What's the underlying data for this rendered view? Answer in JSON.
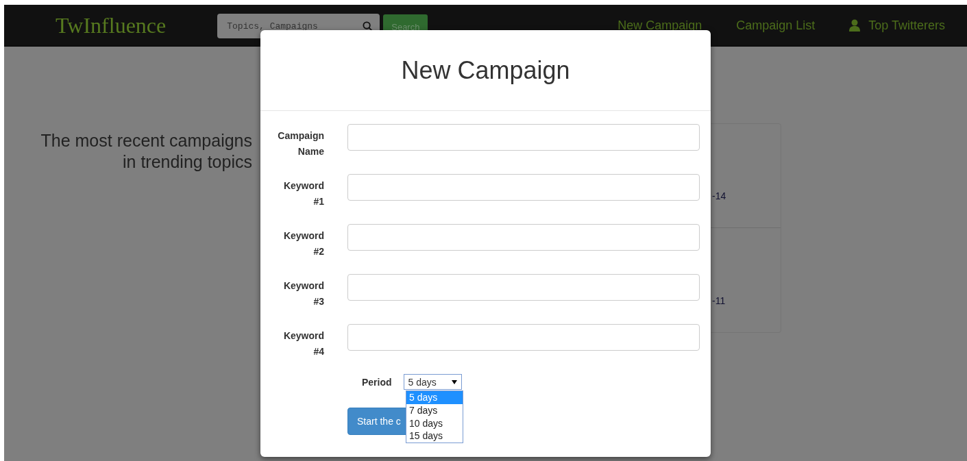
{
  "navbar": {
    "logo": "TwInfluence",
    "search": {
      "placeholder": "Topics, Campaigns",
      "button": "Search"
    },
    "links": [
      {
        "label": "New Campaign",
        "kind": "text"
      },
      {
        "label": "Campaign List",
        "kind": "text"
      },
      {
        "label": "Top Twitterers",
        "kind": "user"
      }
    ]
  },
  "intro": "The most recent campaigns in trending topics",
  "entries": [
    {
      "text": "-14"
    },
    {
      "text": "-11"
    }
  ],
  "modal": {
    "title": "New Campaign",
    "fields": [
      {
        "label": "Campaign Name"
      },
      {
        "label": "Keyword #1"
      },
      {
        "label": "Keyword #2"
      },
      {
        "label": "Keyword #3"
      },
      {
        "label": "Keyword #4"
      }
    ],
    "period": {
      "label": "Period",
      "value": "5 days",
      "options": [
        {
          "label": "5 days",
          "selected": true
        },
        {
          "label": "7 days",
          "selected": false
        },
        {
          "label": "10 days",
          "selected": false
        },
        {
          "label": "15 days",
          "selected": false
        }
      ]
    },
    "submit": "Start the c"
  }
}
